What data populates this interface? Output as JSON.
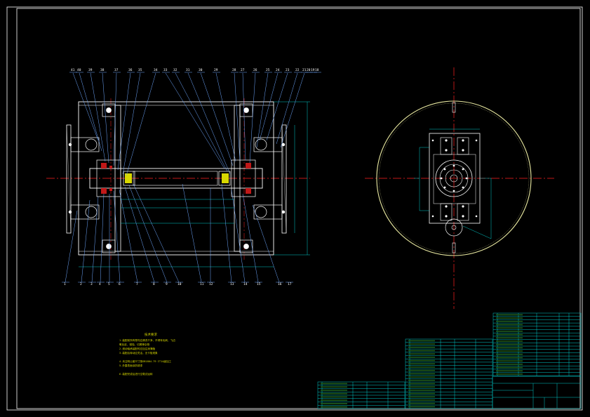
{
  "drawing": {
    "title_block_text": "",
    "notes_heading": "技术要求",
    "notes": [
      "1.装配前所有零件应清洗干净，不得有毛刺、飞边",
      "  氧化皮、锈蚀、切屑等杂物",
      "2.滚动轴承装配时应加注润滑脂",
      "3.装配后转动应灵活，无卡阻现象",
      "4.未注明公差尺寸按GB1804-79 IT14级加工",
      "5.外露表面涂防锈漆",
      "6.装配完成后进行空载试运转"
    ],
    "balloons_top": [
      "41",
      "40",
      "39",
      "38",
      "37",
      "36",
      "35",
      "34",
      "33",
      "32",
      "31",
      "30",
      "29",
      "28",
      "27",
      "26",
      "25",
      "24",
      "23",
      "22",
      "21",
      "20",
      "19",
      "18"
    ],
    "balloons_bottom": [
      "1",
      "2",
      "3",
      "4",
      "5",
      "6",
      "7",
      "8",
      "9",
      "10",
      "11",
      "12",
      "13",
      "14",
      "15",
      "16",
      "17"
    ]
  },
  "colors": {
    "background": "#000000",
    "frame": "#ffffff",
    "part": "#ffffff",
    "center_line": "#ff2020",
    "dimension": "#00c8c8",
    "leader": "#6fa8ff",
    "table": "#00c8c8",
    "note": "#d8d800"
  }
}
